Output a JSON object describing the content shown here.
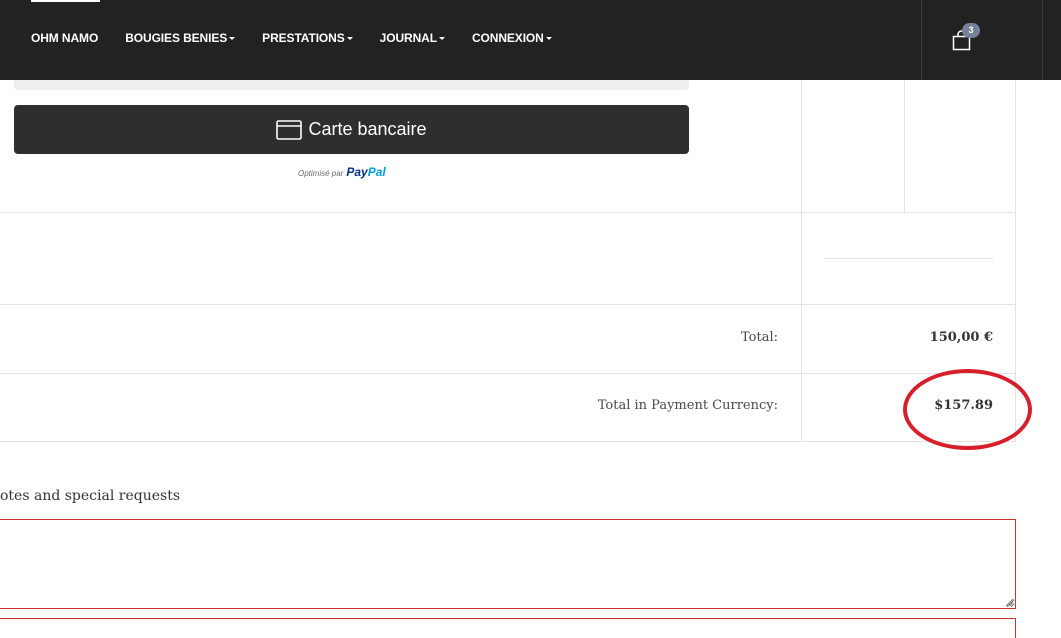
{
  "nav": {
    "items": [
      {
        "label": "OHM NAMO",
        "dropdown": false
      },
      {
        "label": "BOUGIES BENIES",
        "dropdown": true
      },
      {
        "label": "PRESTATIONS",
        "dropdown": true
      },
      {
        "label": "JOURNAL",
        "dropdown": true
      },
      {
        "label": "CONNEXION",
        "dropdown": true
      }
    ],
    "cart_icon": "shopping-bag-icon",
    "cart_count": "3"
  },
  "payment": {
    "card_button_label": "Carte bancaire",
    "card_icon": "credit-card-icon",
    "powered_by": "Optimisé par",
    "paypal_brand_part1": "Pay",
    "paypal_brand_part2": "Pal"
  },
  "totals": {
    "total_label": "Total:",
    "total_value": "150,00 €",
    "payment_currency_label": "Total in Payment Currency:",
    "payment_currency_value": "$157.89"
  },
  "notes": {
    "label": "otes and special requests",
    "value": ""
  },
  "colors": {
    "nav_bg": "#222222",
    "card_button_bg": "#2c2e2f",
    "highlight_ellipse": "#d61f2a",
    "notes_border": "#c8332c",
    "paypal_dark": "#003087",
    "paypal_light": "#009cde"
  }
}
